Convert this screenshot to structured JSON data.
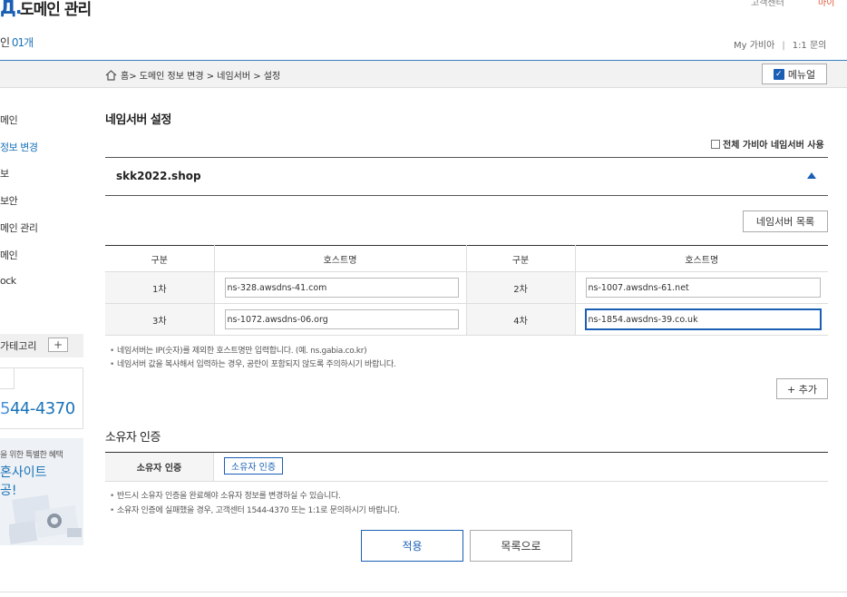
{
  "header": {
    "logo_text": "Д.",
    "title": "도메인 관리",
    "top_right_cut": "고객센터",
    "top_right_cut2": "마이",
    "domain_count_label": "인 ",
    "domain_count_value": "01개",
    "util_my": "My 가비아",
    "util_sep": "|",
    "util_qna": "1:1 문의"
  },
  "breadcrumb": {
    "home": "홈",
    "path": " > 도메인 정보 변경 > 네임서버 > 설정",
    "manual_label": "메뉴얼"
  },
  "sidebar": {
    "items": [
      {
        "label": "메인",
        "active": false
      },
      {
        "label": "정보 변경",
        "active": true
      },
      {
        "label": "보",
        "active": false
      },
      {
        "label": "보안",
        "active": false
      },
      {
        "label": "메인 관리",
        "active": false
      },
      {
        "label": "메인",
        "active": false
      },
      {
        "label": "ock",
        "active": false
      }
    ],
    "category_label": "가테고리",
    "category_add": "+",
    "phone_lead": "5",
    "phone_rest": "44-4370",
    "promo_small": "을 위한 특별한 혜택",
    "promo_big_1": "혼사이트",
    "promo_big_2": "공!"
  },
  "main": {
    "section_title": "네임서버 설정",
    "all_gabia_label": "전체 가비아 네임서버 사용",
    "domain_name": "skk2022.shop",
    "ns_list_button": "네임서버 목록",
    "table": {
      "headers": [
        "구분",
        "호스트명",
        "구분",
        "호스트명"
      ],
      "rows": [
        {
          "label1": "1차",
          "host1": "ns-328.awsdns-41.com",
          "label2": "2차",
          "host2": "ns-1007.awsdns-61.net"
        },
        {
          "label1": "3차",
          "host1": "ns-1072.awsdns-06.org",
          "label2": "4차",
          "host2": "ns-1854.awsdns-39.co.uk"
        }
      ]
    },
    "notes": [
      "네임서버는 IP(숫자)를 제외한 호스트명만 입력합니다. (예. ns.gabia.co.kr)",
      "네임서버 값을 복사해서 입력하는 경우, 공란이 포함되지 않도록 주의하시기 바랍니다."
    ],
    "add_button": "+ 추가",
    "owner": {
      "title": "소유자 인증",
      "row_label": "소유자 인증",
      "button": "소유자 인증",
      "notes": [
        "반드시 소유자 인증을 완료해야 소유자 정보를 변경하실 수 있습니다.",
        "소유자 인증에 실패했을 경우, 고객센터 1544-4370 또는 1:1로 문의하시기 바랍니다."
      ]
    },
    "apply_button": "적용",
    "list_button": "목록으로"
  },
  "colors": {
    "accent": "#1a5fb4",
    "link": "#1a73b8"
  }
}
